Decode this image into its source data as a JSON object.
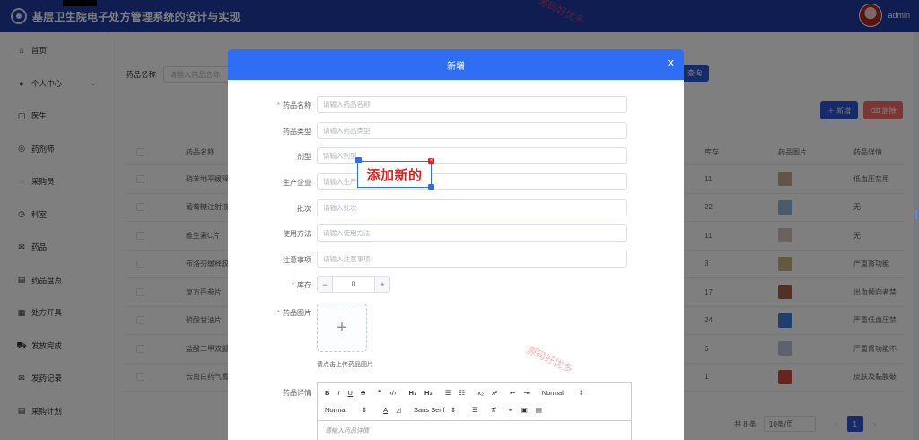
{
  "header": {
    "title": "基层卫生院电子处方管理系统的设计与实现",
    "username": "admin"
  },
  "sidebar": {
    "items": [
      {
        "label": "首页",
        "icon": "home-icon"
      },
      {
        "label": "个人中心",
        "icon": "user-icon",
        "expandable": true
      },
      {
        "label": "医生",
        "icon": "doctor-icon"
      },
      {
        "label": "药剂师",
        "icon": "pharmacist-icon"
      },
      {
        "label": "采购员",
        "icon": "chat-icon"
      },
      {
        "label": "科室",
        "icon": "clock-icon"
      },
      {
        "label": "药品",
        "icon": "mail-icon"
      },
      {
        "label": "药品盘点",
        "icon": "doc-icon"
      },
      {
        "label": "处方开具",
        "icon": "calendar-icon"
      },
      {
        "label": "发放完成",
        "icon": "car-icon"
      },
      {
        "label": "发药记录",
        "icon": "mail-icon"
      },
      {
        "label": "采购计划",
        "icon": "doc-icon"
      }
    ]
  },
  "search": {
    "label": "药品名称",
    "placeholder": "请输入药品名称",
    "button": "查询"
  },
  "actions": {
    "add": "新增",
    "delete": "删除"
  },
  "table": {
    "headers": {
      "name": "药品名称",
      "stock": "库存",
      "image": "药品图片",
      "detail": "药品详情"
    },
    "rows": [
      {
        "name": "硝苯地平缓释",
        "stock": "11",
        "detail": "低血压禁用"
      },
      {
        "name": "葡萄糖注射液",
        "stock": "22",
        "detail": "无"
      },
      {
        "name": "维生素C片",
        "stock": "11",
        "detail": "无"
      },
      {
        "name": "布洛芬缓释胶",
        "stock": "3",
        "detail": "严重肾功能"
      },
      {
        "name": "复方丹参片",
        "stock": "17",
        "detail": "出血倾向者禁"
      },
      {
        "name": "硝酸甘油片",
        "stock": "24",
        "detail": "严重低血压禁"
      },
      {
        "name": "盐酸二甲双胍",
        "stock": "6",
        "detail": "严重肾功能不"
      },
      {
        "name": "云南白药气雾",
        "stock": "1",
        "detail": "皮肤及黏膜破"
      }
    ]
  },
  "pagination": {
    "total": "共 8 条",
    "page_size": "10条/页",
    "current_page": "1"
  },
  "dialog": {
    "title": "新增",
    "fields": [
      {
        "label": "药品名称",
        "required": true,
        "placeholder": "请输入药品名称"
      },
      {
        "label": "药品类型",
        "required": false,
        "placeholder": "请输入药品类型"
      },
      {
        "label": "剂型",
        "required": false,
        "placeholder": "请输入剂型"
      },
      {
        "label": "生产企业",
        "required": false,
        "placeholder": "请输入生产企业"
      },
      {
        "label": "批次",
        "required": false,
        "placeholder": "请输入批次"
      },
      {
        "label": "使用方法",
        "required": false,
        "placeholder": "请输入使用方法"
      },
      {
        "label": "注意事项",
        "required": false,
        "placeholder": "请输入注意事项"
      }
    ],
    "stock": {
      "label": "库存",
      "value": "0",
      "minus": "−",
      "plus": "+"
    },
    "image": {
      "label": "药品图片",
      "plus": "+",
      "tip": "请点击上传药品图片"
    },
    "detail": {
      "label": "药品详情",
      "header_select": "Normal",
      "size_select": "Normal",
      "font_select": "Sans Serif",
      "placeholder": "请输入药品详情"
    }
  },
  "sticker": {
    "text": "添加新的"
  },
  "watermarks": [
    "源码好优多",
    "源码好优多"
  ]
}
